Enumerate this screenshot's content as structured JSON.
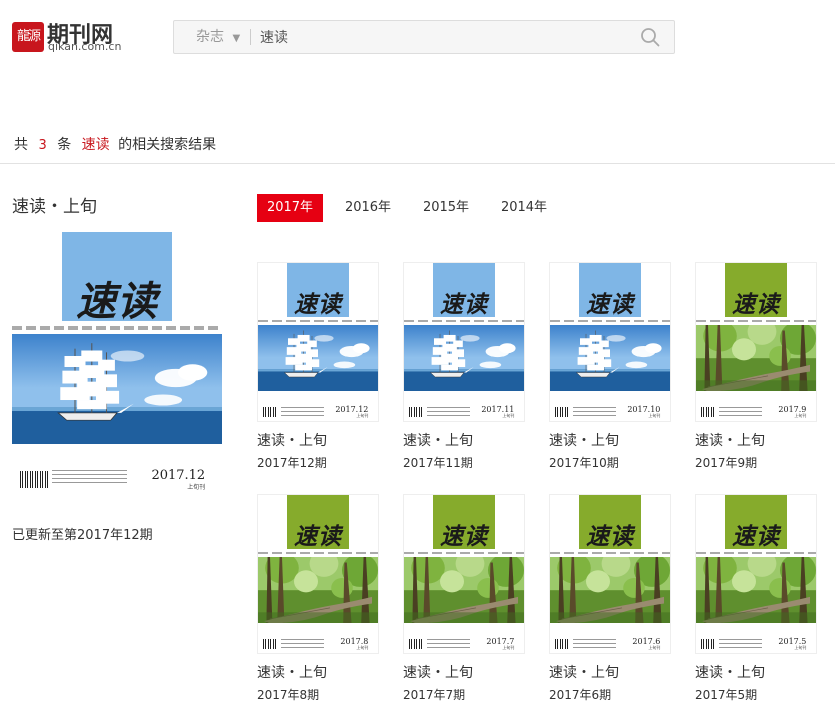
{
  "header": {
    "logo_badge_text": "龍源",
    "logo_cn": "期刊网",
    "logo_en": "qikan.com.cn",
    "search_scope": "杂志",
    "search_value": "速读"
  },
  "summary": {
    "prefix": "共",
    "count": "3",
    "unit": "条",
    "keyword": "速读",
    "suffix": "的相关搜索结果"
  },
  "featured": {
    "title": "速读・上旬",
    "status": "已更新至第2017年12期",
    "cover": {
      "logo_text": "速读",
      "date": "2017.12",
      "half": "上旬刊",
      "theme": "sea",
      "logo_color": "#7fb6e6"
    }
  },
  "year_tabs": [
    "2017年",
    "2016年",
    "2015年",
    "2014年"
  ],
  "active_year_index": 0,
  "issues": [
    {
      "title": "速读・上旬",
      "issue": "2017年12期",
      "cover_date": "2017.12",
      "theme": "sea"
    },
    {
      "title": "速读・上旬",
      "issue": "2017年11期",
      "cover_date": "2017.11",
      "theme": "sea"
    },
    {
      "title": "速读・上旬",
      "issue": "2017年10期",
      "cover_date": "2017.10",
      "theme": "sea"
    },
    {
      "title": "速读・上旬",
      "issue": "2017年9期",
      "cover_date": "2017.9",
      "theme": "forest"
    },
    {
      "title": "速读・上旬",
      "issue": "2017年8期",
      "cover_date": "2017.8",
      "theme": "forest"
    },
    {
      "title": "速读・上旬",
      "issue": "2017年7期",
      "cover_date": "2017.7",
      "theme": "forest"
    },
    {
      "title": "速读・上旬",
      "issue": "2017年6期",
      "cover_date": "2017.6",
      "theme": "forest"
    },
    {
      "title": "速读・上旬",
      "issue": "2017年5期",
      "cover_date": "2017.5",
      "theme": "forest"
    }
  ],
  "colors": {
    "accent": "#e60012",
    "highlight": "#c8161d",
    "sea_logo": "#7fb6e6",
    "forest_logo": "#86ab2c"
  },
  "icons": {
    "search": "search-icon",
    "dropdown": "caret-down-icon"
  }
}
